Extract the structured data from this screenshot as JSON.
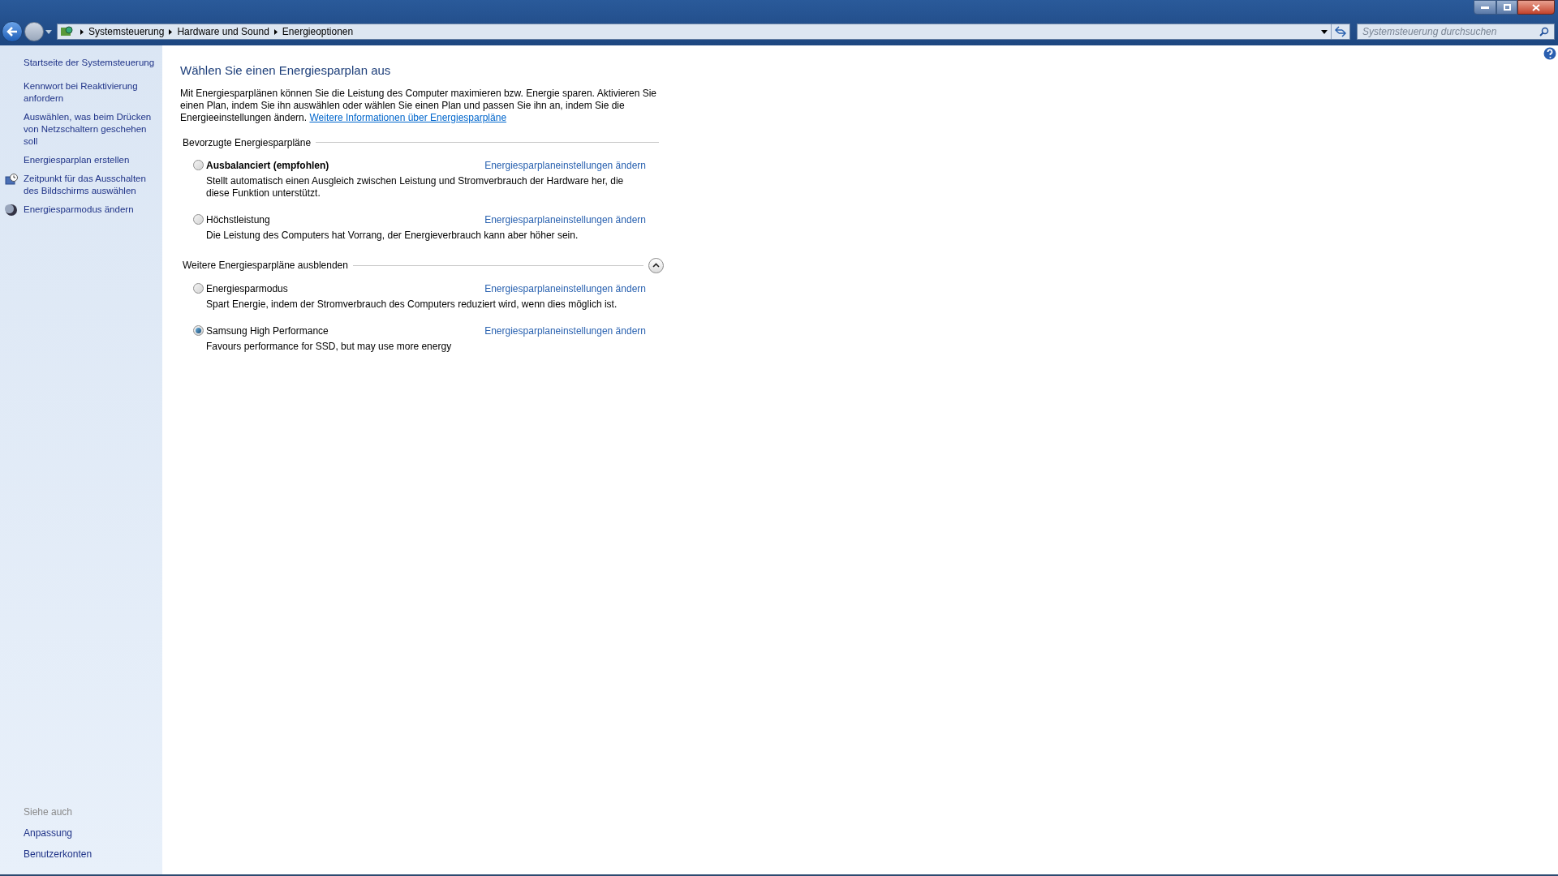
{
  "address_bar": {
    "breadcrumbs": [
      "Systemsteuerung",
      "Hardware und Sound",
      "Energieoptionen"
    ]
  },
  "search": {
    "placeholder": "Systemsteuerung durchsuchen"
  },
  "sidebar": {
    "items": [
      {
        "label": "Startseite der Systemsteuerung",
        "kind": "plain"
      },
      {
        "label": "Kennwort bei Reaktivierung anfordern",
        "kind": "plain"
      },
      {
        "label": "Auswählen, was beim Drücken von Netzschaltern geschehen soll",
        "kind": "plain"
      },
      {
        "label": "Energiesparplan erstellen",
        "kind": "plain"
      },
      {
        "label": "Zeitpunkt für das Ausschalten des Bildschirms auswählen",
        "kind": "clock"
      },
      {
        "label": "Energiesparmodus ändern",
        "kind": "moon"
      }
    ],
    "see_also": {
      "heading": "Siehe auch",
      "items": [
        "Anpassung",
        "Benutzerkonten"
      ]
    }
  },
  "content": {
    "title": "Wählen Sie einen Energiesparplan aus",
    "intro": "Mit Energiesparplänen können Sie die Leistung des Computer maximieren bzw. Energie sparen. Aktivieren Sie einen Plan, indem Sie ihn auswählen oder wählen Sie einen Plan und passen Sie ihn an, indem Sie die Energieeinstellungen ändern.",
    "intro_link": "Weitere Informationen über Energiesparpläne",
    "groups": [
      {
        "heading": "Bevorzugte Energiesparpläne",
        "plans": [
          {
            "name": "Ausbalanciert (empfohlen)",
            "emphasized": true,
            "selected": false,
            "link": "Energiesparplaneinstellungen ändern",
            "description": "Stellt automatisch einen Ausgleich zwischen Leistung und Stromverbrauch der Hardware her, die diese Funktion unterstützt."
          },
          {
            "name": "Höchstleistung",
            "emphasized": false,
            "selected": false,
            "link": "Energiesparplaneinstellungen ändern",
            "description": "Die Leistung des Computers hat Vorrang, der Energieverbrauch kann aber höher sein."
          }
        ]
      },
      {
        "heading": "Weitere Energiesparpläne ausblenden",
        "expanded": true,
        "plans": [
          {
            "name": "Energiesparmodus",
            "emphasized": false,
            "selected": false,
            "link": "Energiesparplaneinstellungen ändern",
            "description": "Spart Energie, indem der Stromverbrauch des Computers reduziert wird, wenn dies möglich ist."
          },
          {
            "name": "Samsung High Performance",
            "emphasized": false,
            "selected": true,
            "link": "Energiesparplaneinstellungen ändern",
            "description": "Favours performance for SSD, but may use more energy"
          }
        ]
      }
    ]
  }
}
